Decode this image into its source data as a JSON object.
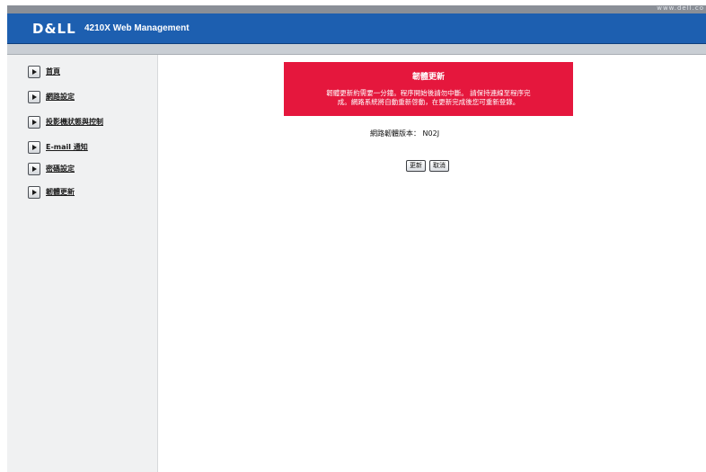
{
  "header": {
    "url_text": "www.dell.co",
    "logo": "D&LL",
    "product_title": "4210X Web Management"
  },
  "sidebar": {
    "items": [
      {
        "label": "首頁"
      },
      {
        "label": "網路設定"
      },
      {
        "label": "投影機狀態與控制"
      },
      {
        "label": "E-mail 通知"
      },
      {
        "label": "密碼設定"
      },
      {
        "label": "韌體更新"
      }
    ]
  },
  "main": {
    "alert": {
      "title": "韌體更新",
      "line1": "韌體更新約需要一分鐘。程序開始後請勿中斷。 請保持連線至程序完",
      "line2": "成。網路系統將自動重新啓動，在更新完成後您可重新登錄。"
    },
    "firmware_label": "網路韌體版本： N02J",
    "update_button": "更新",
    "cancel_button": "取消"
  },
  "colors": {
    "banner": "#1d5fb0",
    "alert": "#e5173d",
    "sidebar": "#f0f1f2"
  }
}
